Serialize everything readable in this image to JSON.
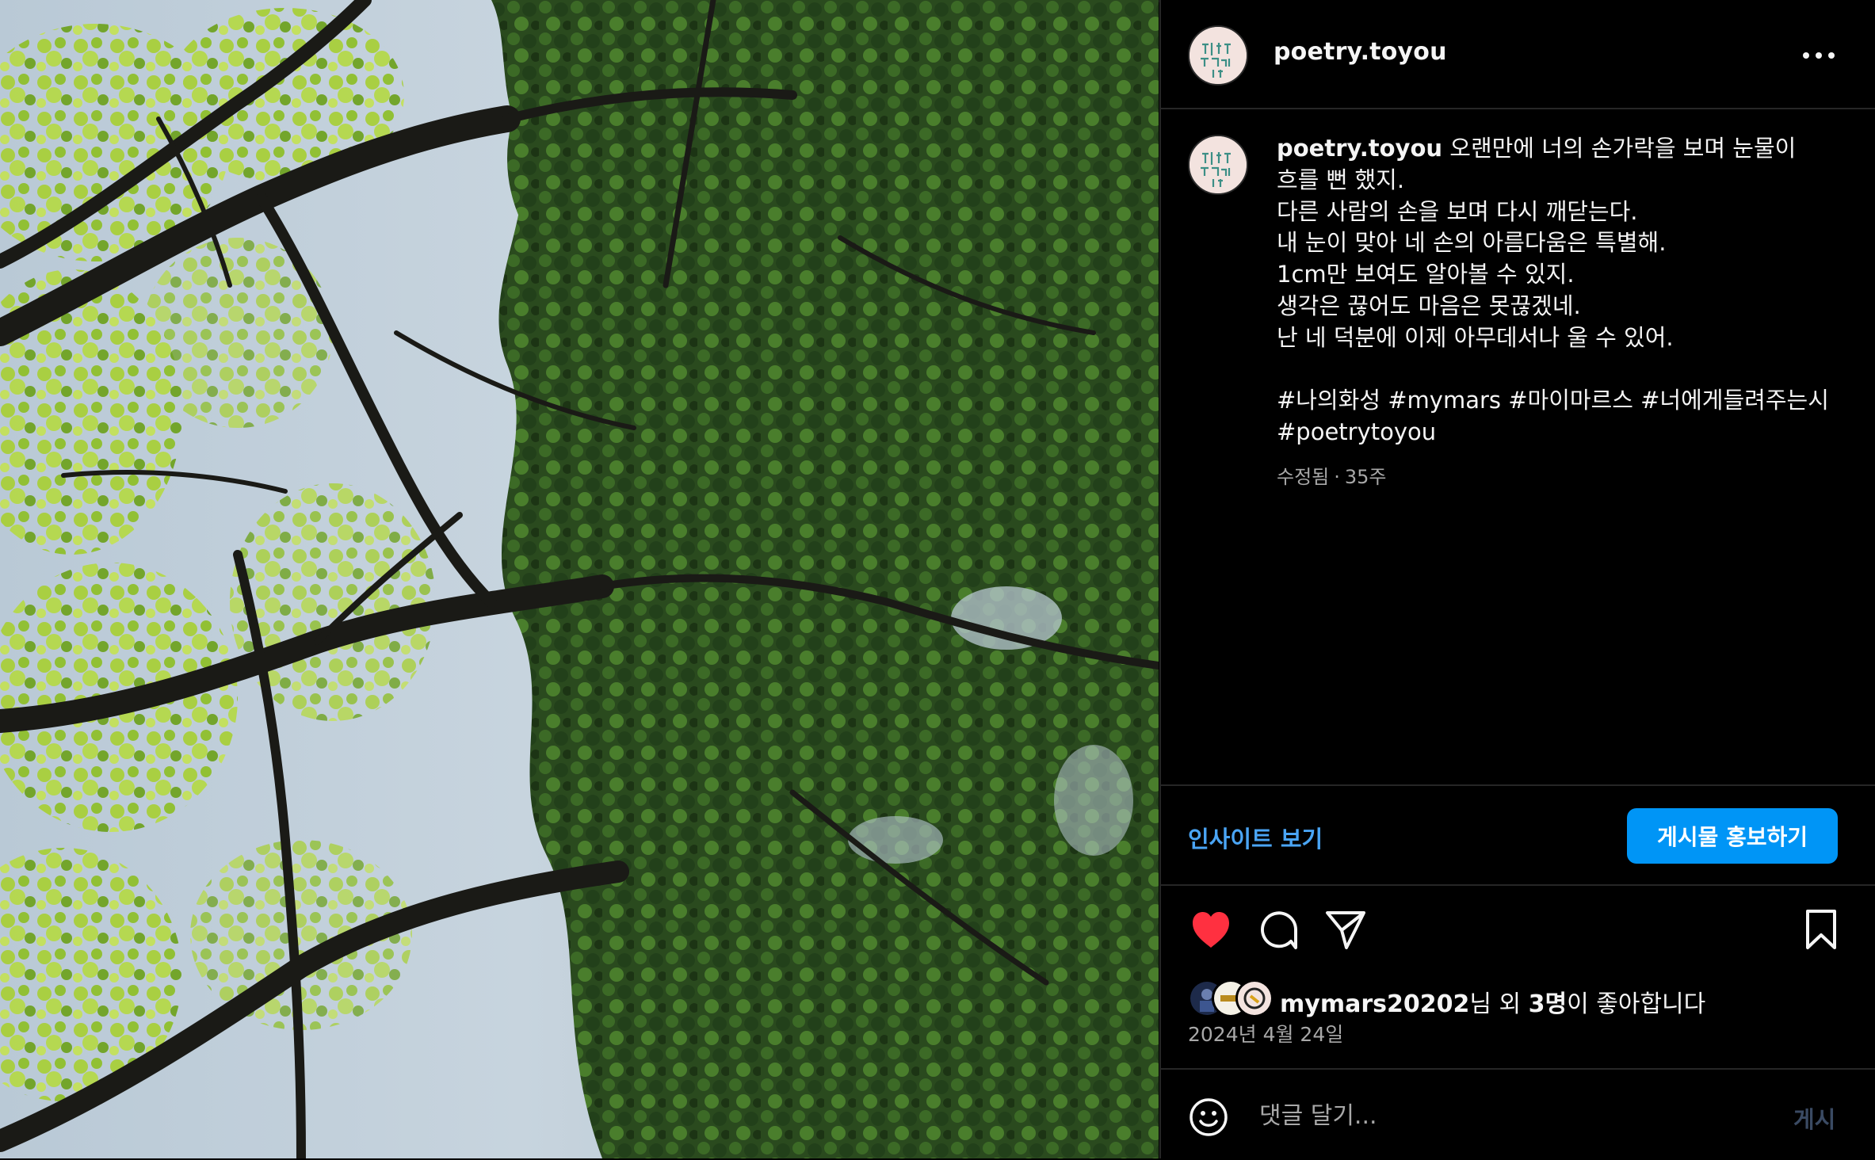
{
  "post": {
    "image": {
      "description_icon": "tree-canopy-photo"
    },
    "header": {
      "username": "poetry.toyou",
      "more_icon": "more-horizontal-icon"
    },
    "caption": {
      "username": "poetry.toyou",
      "text": " 오랜만에 너의 손가락을 보며 눈물이 흐를 뻔 했지.\n다른 사람의 손을 보며 다시 깨닫는다.\n내 눈이 맞아 네 손의 아름다움은 특별해.\n1cm만 보여도 알아볼 수 있지.\n생각은 끊어도 마음은 못끊겠네.\n난 네 덕분에 이제 아무데서나 울 수 있어.\n\n#나의화성 #mymars #마이마르스 #너에게들려주는시 #poetrytoyou",
      "edited": "수정됨",
      "separator": "·",
      "age": "35주"
    },
    "insights": {
      "link_label": "인사이트 보기",
      "promote_label": "게시물 홍보하기"
    },
    "likes": {
      "liked_by_user": "mymars20202",
      "suffix_1": "님 외 ",
      "others_count": "3명",
      "suffix_2": "이 좋아합니다"
    },
    "date": "2024년 4월 24일",
    "comment": {
      "placeholder": "댓글 달기...",
      "post_label": "게시"
    }
  },
  "colors": {
    "accent": "#0095f6",
    "like_red": "#ff3040",
    "background": "#000000"
  }
}
